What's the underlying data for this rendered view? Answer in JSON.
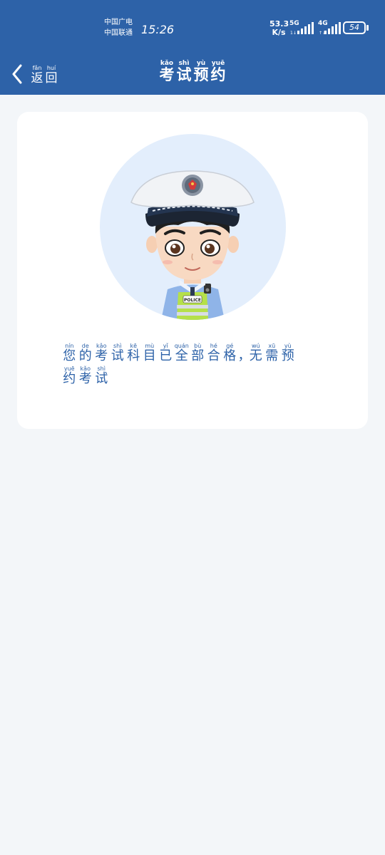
{
  "status_bar": {
    "carrier_line1": "中国广电",
    "carrier_line2": "中国联通",
    "time": "15:26",
    "net_speed_value": "53.3",
    "net_speed_unit": "K/s",
    "signal1_tag": "5G",
    "signal2_tag": "4G",
    "battery": "54"
  },
  "nav": {
    "back": [
      {
        "py": "fǎn",
        "hz": "返"
      },
      {
        "py": "huí",
        "hz": "回"
      }
    ],
    "title": [
      {
        "py": "kǎo",
        "hz": "考"
      },
      {
        "py": "shì",
        "hz": "试"
      },
      {
        "py": "yù",
        "hz": "预"
      },
      {
        "py": "yuē",
        "hz": "约"
      }
    ]
  },
  "message": [
    {
      "py": "nín",
      "hz": "您"
    },
    {
      "py": "de",
      "hz": "的"
    },
    {
      "py": "kǎo",
      "hz": "考"
    },
    {
      "py": "shì",
      "hz": "试"
    },
    {
      "py": "kē",
      "hz": "科"
    },
    {
      "py": "mù",
      "hz": "目"
    },
    {
      "py": "yǐ",
      "hz": "已"
    },
    {
      "py": "quán",
      "hz": "全"
    },
    {
      "py": "bù",
      "hz": "部"
    },
    {
      "py": "hé",
      "hz": "合"
    },
    {
      "py": "gé",
      "hz": "格"
    },
    {
      "py": "",
      "hz": "，"
    },
    {
      "py": "wú",
      "hz": "无"
    },
    {
      "py": "xū",
      "hz": "需"
    },
    {
      "py": "yù",
      "hz": "预"
    },
    {
      "py": "yuē",
      "hz": "约"
    },
    {
      "py": "kǎo",
      "hz": "考"
    },
    {
      "py": "shì",
      "hz": "试"
    }
  ],
  "avatar": {
    "badge_text": "POLICE"
  },
  "colors": {
    "header": "#2d62a8",
    "background": "#f3f6f9",
    "avatar_bg": "#e3eefc",
    "message_text": "#2d62a8"
  }
}
